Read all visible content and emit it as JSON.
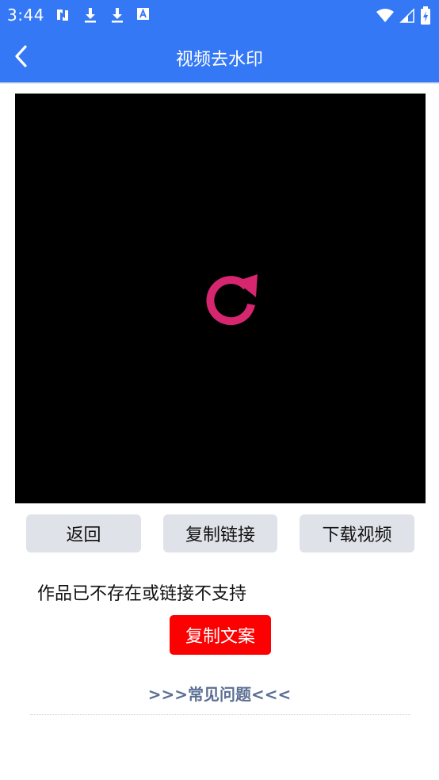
{
  "status_bar": {
    "time": "3:44",
    "left_icons": [
      "sync-icon",
      "download-icon",
      "download-icon",
      "font-icon"
    ],
    "right_icons": [
      "wifi-icon",
      "signal-icon",
      "battery-icon"
    ]
  },
  "header": {
    "title": "视频去水印",
    "back_icon": "chevron-left-icon",
    "background_color": "#3478f6"
  },
  "video": {
    "background_color": "#000000",
    "overlay_icon": "replay-icon",
    "icon_color": "#d6266f"
  },
  "actions": {
    "back_label": "返回",
    "copy_link_label": "复制链接",
    "download_video_label": "下载视频"
  },
  "message": "作品已不存在或链接不支持",
  "copy_text_button": {
    "label": "复制文案",
    "color": "#fb0101"
  },
  "faq_link": ">>>常见问题<<<"
}
